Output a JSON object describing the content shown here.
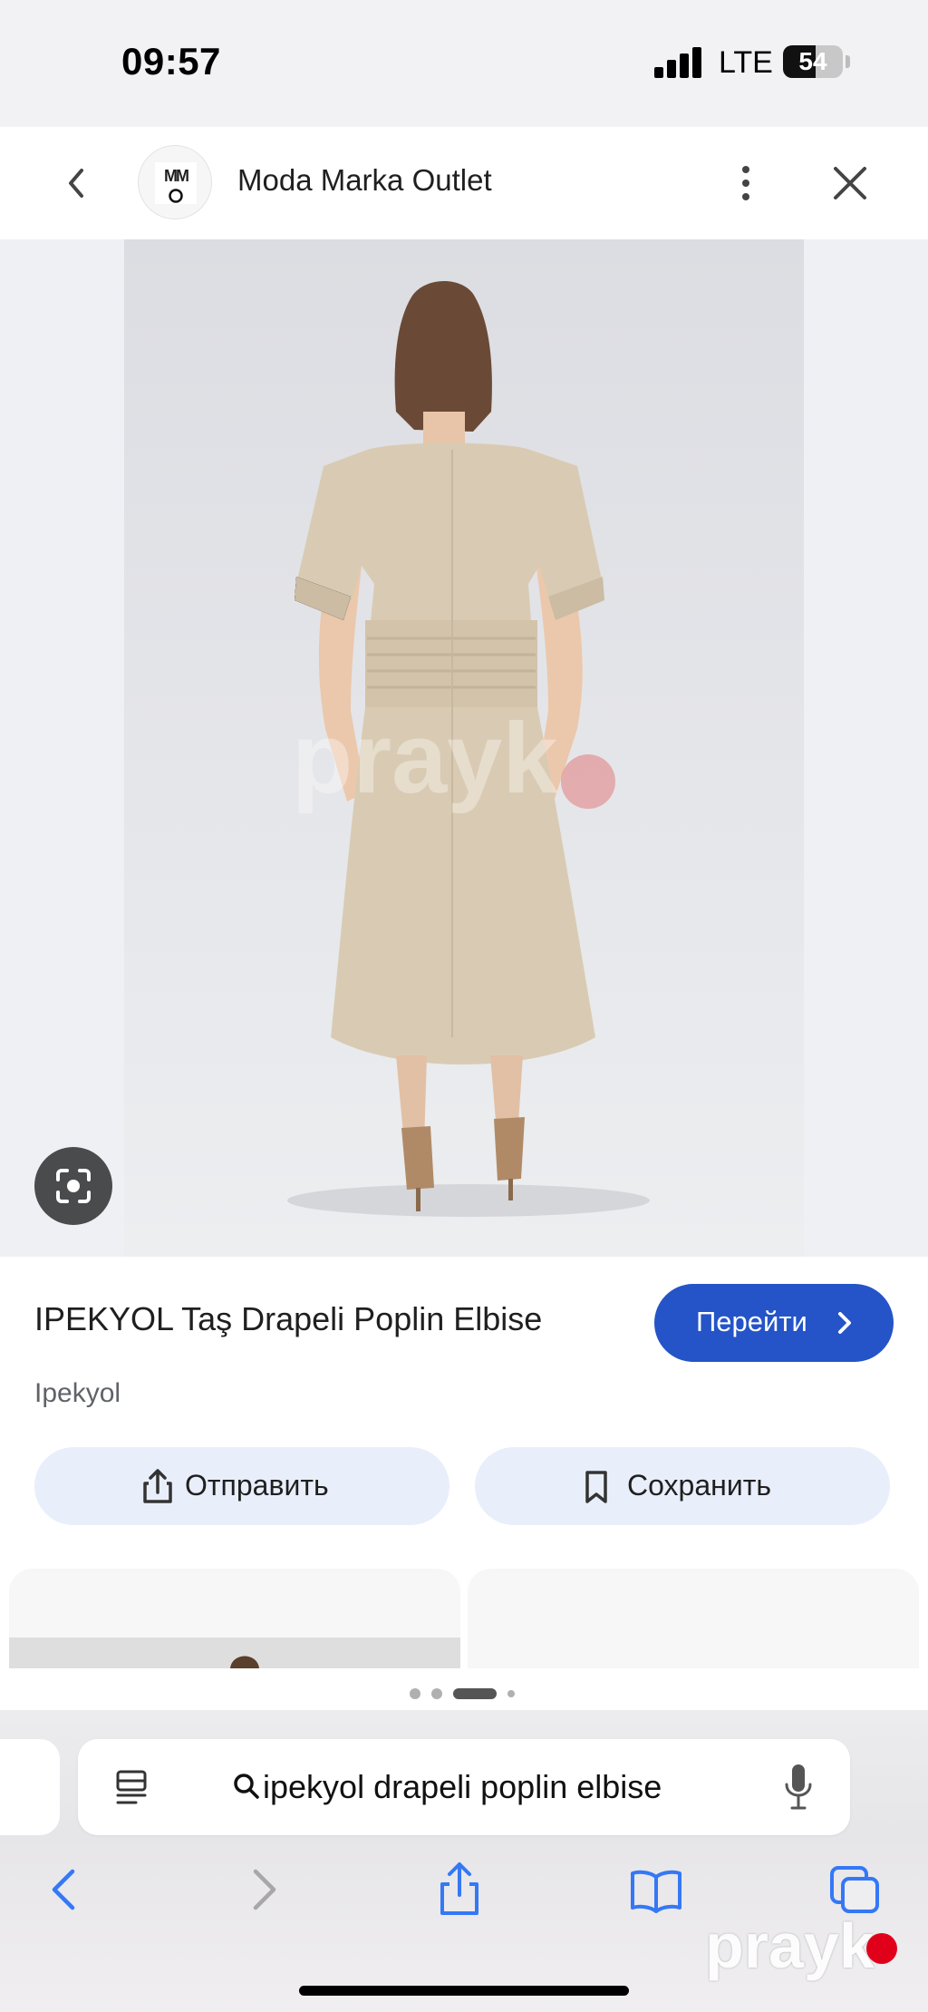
{
  "status_bar": {
    "time": "09:57",
    "network": "LTE",
    "battery": "54"
  },
  "header": {
    "site_name": "Moda Marka Outlet",
    "logo_text": "MM"
  },
  "product": {
    "title": "IPEKYOL Taş Drapeli Poplin Elbise",
    "brand": "Ipekyol",
    "goto_label": "Перейти",
    "share_label": "Отправить",
    "save_label": "Сохранить"
  },
  "watermark": {
    "text": "prayk"
  },
  "search": {
    "query": "ipekyol drapeli poplin elbise"
  },
  "colors": {
    "accent": "#2454c7",
    "action_bg": "#e9eefb",
    "dress": "#d9cbb3"
  },
  "icons": [
    "chevron-left-icon",
    "more-vert-icon",
    "close-icon",
    "google-lens-icon",
    "chevron-right-icon",
    "share-icon",
    "bookmark-icon",
    "reader-icon",
    "search-icon",
    "mic-icon",
    "back-arrow-icon",
    "forward-arrow-icon",
    "bookmarks-icon",
    "tabs-icon"
  ]
}
